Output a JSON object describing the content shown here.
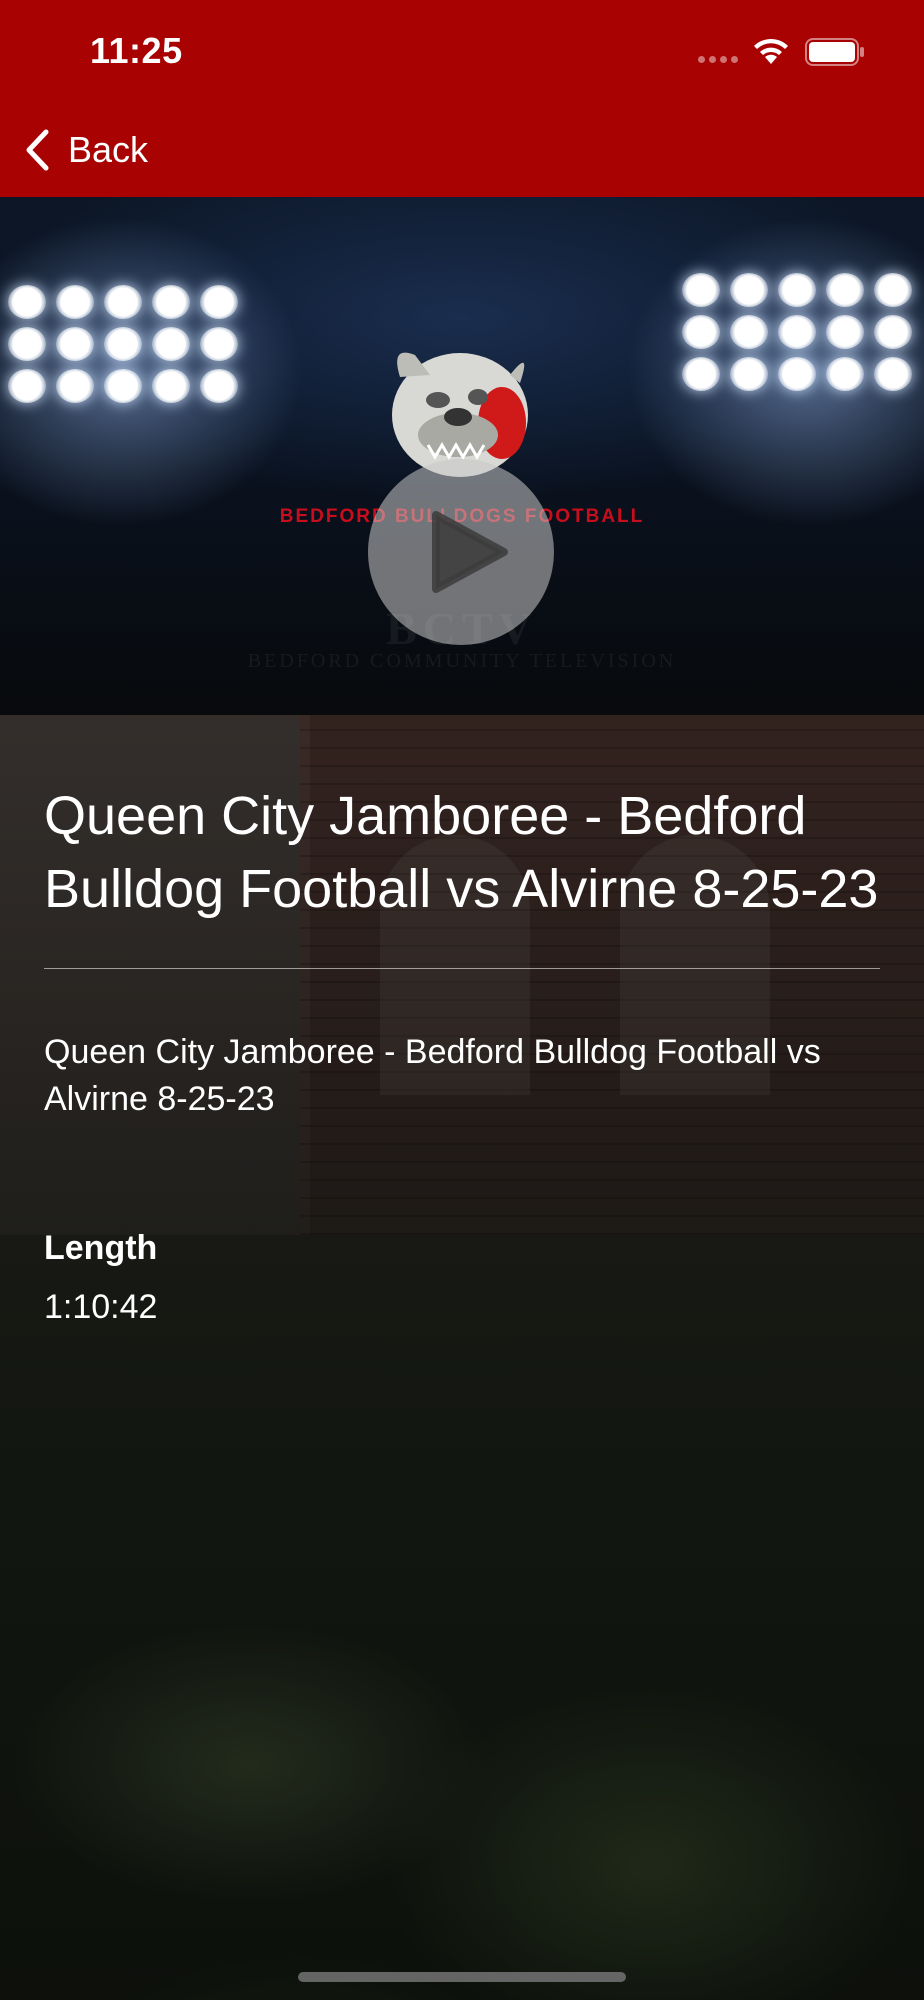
{
  "status_bar": {
    "time": "11:25"
  },
  "nav": {
    "back_label": "Back"
  },
  "video": {
    "logo_text": "BEDFORD BULLDOGS FOOTBALL",
    "watermark": "BCTV",
    "watermark_sub": "BEDFORD COMMUNITY TELEVISION"
  },
  "detail": {
    "title": "Queen City  Jamboree - Bedford Bulldog Football vs Alvirne 8-25-23",
    "description": "Queen City  Jamboree - Bedford Bulldog Football vs Alvirne 8-25-23",
    "length_label": "Length",
    "length_value": "1:10:42"
  },
  "colors": {
    "header": "#a80202",
    "logo_text": "#c80d1c"
  },
  "icons": [
    "chevron-left-icon",
    "wifi-icon",
    "battery-icon",
    "play-icon",
    "bulldog-logo"
  ]
}
